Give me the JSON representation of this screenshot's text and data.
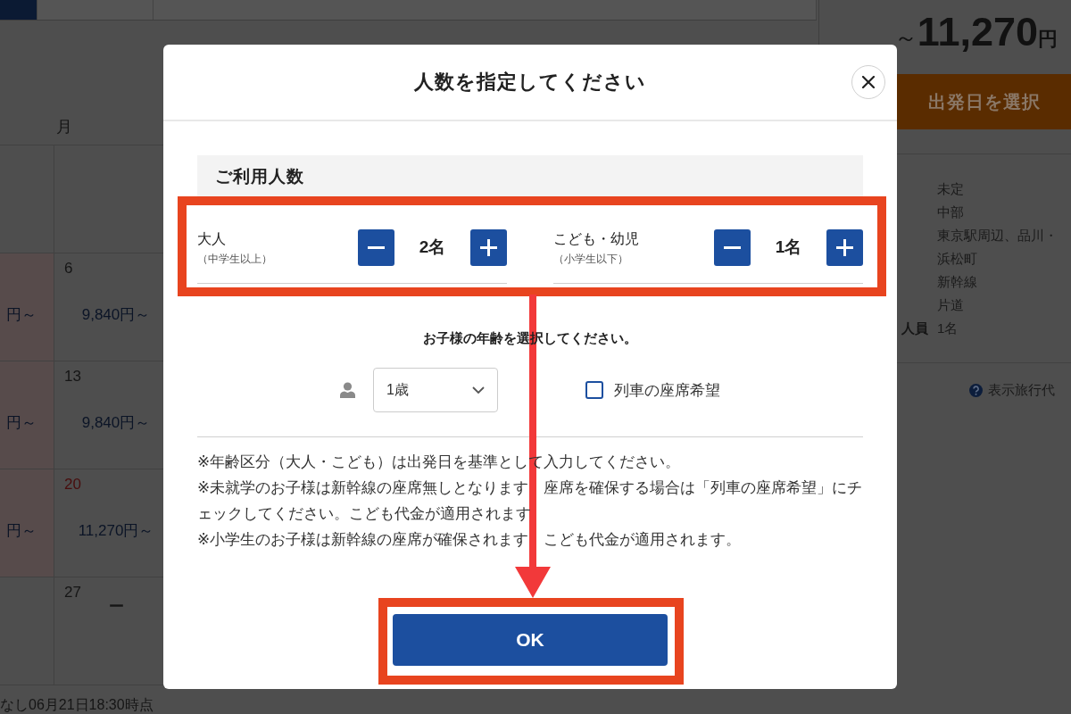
{
  "background_page": {
    "header_tabs": [
      {
        "selected": true
      },
      {
        "selected": false
      },
      {
        "selected": false
      }
    ],
    "calendar": {
      "weekday": "月",
      "weeks": [
        {
          "cells": [
            {
              "kind": "blank"
            },
            {
              "kind": "blank"
            }
          ]
        },
        {
          "cells": [
            {
              "kind": "fragment",
              "price": "円～"
            },
            {
              "kind": "day",
              "date": "6",
              "price": "9,840円～",
              "holiday": false
            }
          ]
        },
        {
          "cells": [
            {
              "kind": "fragment",
              "price": "円～"
            },
            {
              "kind": "day",
              "date": "13",
              "price": "9,840円～",
              "holiday": false
            }
          ]
        },
        {
          "cells": [
            {
              "kind": "fragment",
              "price": "円～"
            },
            {
              "kind": "day",
              "date": "20",
              "price": "11,270円～",
              "holiday": true
            }
          ]
        },
        {
          "cells": [
            {
              "kind": "blank"
            },
            {
              "kind": "unavailable",
              "date": "27",
              "price": "ー",
              "holiday": false
            }
          ]
        }
      ],
      "footnote": "なし06月21日18:30時点"
    },
    "side_panel": {
      "price": {
        "prefix": "～",
        "amount": "11,270",
        "unit": "円"
      },
      "select_date_button": "出発日を選択",
      "details": [
        {
          "value": "未定"
        },
        {
          "value": "中部"
        },
        {
          "value": "東京駅周辺、品川・"
        },
        {
          "value": "浜松町"
        },
        {
          "value": "新幹線"
        },
        {
          "value": "片道"
        },
        {
          "label": "人員",
          "value": "1名"
        }
      ],
      "help_link": "表示旅行代"
    }
  },
  "dialog": {
    "title": "人数を指定してください",
    "section_title": "ご利用人数",
    "counters": [
      {
        "label": "大人",
        "sublabel": "（中学生以上）",
        "value": "2名"
      },
      {
        "label": "こども・幼児",
        "sublabel": "（小学生以下）",
        "value": "1名"
      }
    ],
    "child_age_prompt": "お子様の年齢を選択してください。",
    "child_age": {
      "value": "1歳"
    },
    "seat_request": {
      "label": "列車の座席希望",
      "checked": false
    },
    "notes": [
      "※年齢区分（大人・こども）は出発日を基準として入力してください。",
      "※未就学のお子様は新幹線の座席無しとなります　座席を確保する場合は「列車の座席希望」にチェックしてください。こども代金が適用されます",
      "※小学生のお子様は新幹線の座席が確保されます　こども代金が適用されます。"
    ],
    "ok_button": "OK"
  }
}
